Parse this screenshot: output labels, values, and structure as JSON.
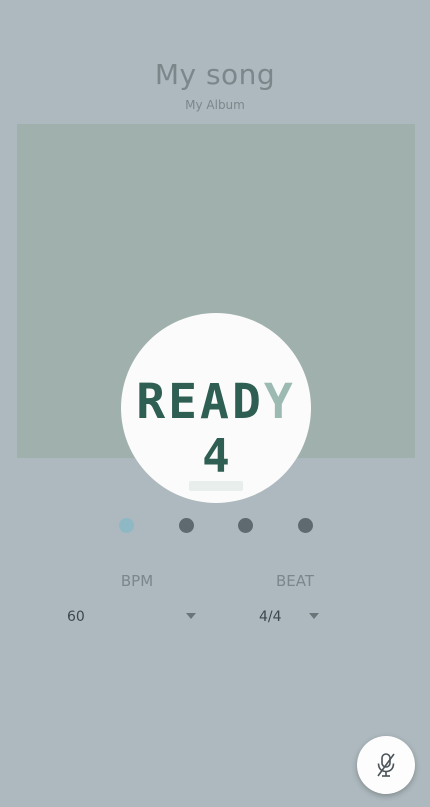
{
  "song": {
    "title": "My song",
    "album": "My Album"
  },
  "overlay": {
    "ready_main": "READ",
    "ready_fade": "Y",
    "countdown": "4"
  },
  "beat_indicator": {
    "total": 4,
    "active_index": 0,
    "active_color": "#8fb8c5",
    "inactive_color": "#5e6a70"
  },
  "settings": {
    "bpm_label": "BPM",
    "beat_label": "BEAT",
    "bpm_value": "60",
    "beat_value": "4/4"
  },
  "fab": {
    "icon": "mic-off-icon"
  },
  "colors": {
    "background": "#adb9be",
    "artwork": "#9fb0ad",
    "accent_dark_green": "#2f5e52"
  }
}
